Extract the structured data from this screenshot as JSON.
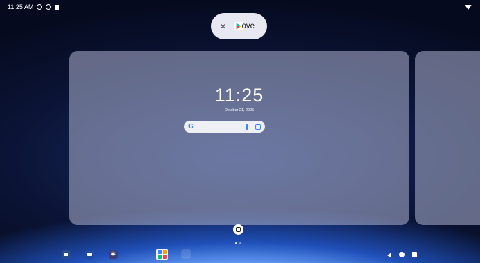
{
  "status_bar": {
    "time": "11:25 AM",
    "icons": [
      "settings-icon",
      "shield-icon",
      "stop-icon",
      "wifi-icon"
    ]
  },
  "remove_pill": {
    "close_glyph": "×",
    "label": "ove",
    "app_icon": "play-store-icon"
  },
  "recent_task": {
    "clock": "11:25",
    "date": "October 21, 2025",
    "search_logo": "G",
    "search_icons": [
      "mic-icon",
      "lens-icon"
    ]
  },
  "taskbar": {
    "apps": [
      "remote-app-icon",
      "files-icon",
      "settings-icon",
      "app-grid-icon"
    ],
    "nav": [
      "back-icon",
      "home-icon",
      "recents-icon"
    ]
  },
  "page_indicator": {
    "count": 2,
    "active": 0
  }
}
